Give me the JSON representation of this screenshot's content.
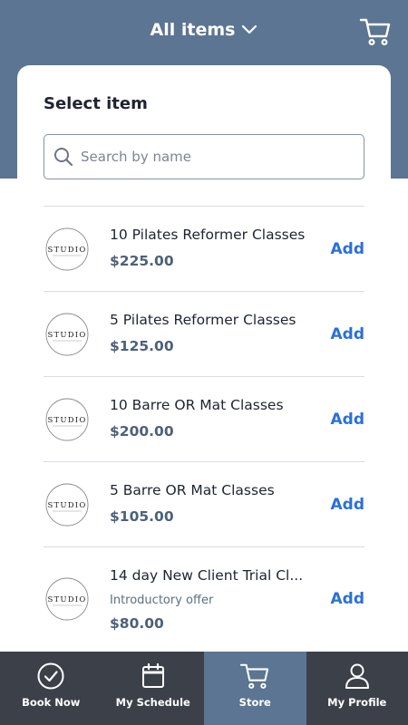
{
  "header": {
    "title": "All items",
    "title_icon": "chevron-down-icon",
    "cart_icon": "cart-icon"
  },
  "panel": {
    "title": "Select item",
    "search": {
      "placeholder": "Search by name",
      "value": "",
      "icon": "search-icon"
    }
  },
  "items": [
    {
      "name": "10 Pilates Reformer Classes",
      "subtitle": "",
      "price": "$225.00",
      "add_label": "Add",
      "logo_text": "STUDIO"
    },
    {
      "name": "5 Pilates Reformer Classes",
      "subtitle": "",
      "price": "$125.00",
      "add_label": "Add",
      "logo_text": "STUDIO"
    },
    {
      "name": "10 Barre OR Mat Classes",
      "subtitle": "",
      "price": "$200.00",
      "add_label": "Add",
      "logo_text": "STUDIO"
    },
    {
      "name": "5 Barre OR Mat Classes",
      "subtitle": "",
      "price": "$105.00",
      "add_label": "Add",
      "logo_text": "STUDIO"
    },
    {
      "name": "14 day New Client Trial Cl...",
      "subtitle": "Introductory offer",
      "price": "$80.00",
      "add_label": "Add",
      "logo_text": "STUDIO"
    }
  ],
  "tabs": [
    {
      "label": "Book Now",
      "icon": "check-circle-icon",
      "active": false
    },
    {
      "label": "My Schedule",
      "icon": "calendar-icon",
      "active": false
    },
    {
      "label": "Store",
      "icon": "cart-icon",
      "active": true
    },
    {
      "label": "My Profile",
      "icon": "person-icon",
      "active": false
    }
  ],
  "colors": {
    "header_bg": "#5b7593",
    "tabbar_bg": "#3c4149",
    "accent": "#2a6fdb",
    "price": "#4c617a"
  }
}
